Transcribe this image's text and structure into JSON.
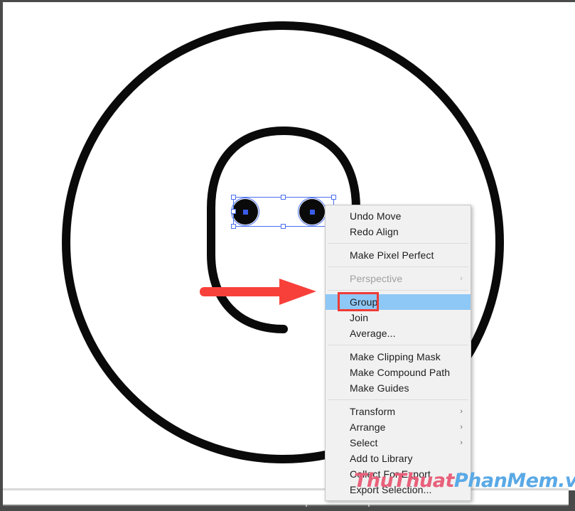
{
  "app": {
    "artwork_description": "Letter G vector outline with two selected circular eye shapes",
    "stroke_color": "#0a0a0a",
    "selection_color": "#4a6ff0"
  },
  "annotation": {
    "arrow_color": "#f8403a",
    "marker_color": "#ef3b36",
    "marker_target": "Group"
  },
  "context_menu": {
    "highlight_color": "#8ec8f6",
    "background_color": "#f1f1f1",
    "groups": [
      {
        "items": [
          {
            "label": "Undo Move",
            "disabled": false,
            "submenu": false,
            "highlighted": false
          },
          {
            "label": "Redo Align",
            "disabled": false,
            "submenu": false,
            "highlighted": false
          }
        ]
      },
      {
        "items": [
          {
            "label": "Make Pixel Perfect",
            "disabled": false,
            "submenu": false,
            "highlighted": false
          }
        ]
      },
      {
        "items": [
          {
            "label": "Perspective",
            "disabled": true,
            "submenu": true,
            "highlighted": false
          }
        ]
      },
      {
        "items": [
          {
            "label": "Group",
            "disabled": false,
            "submenu": false,
            "highlighted": true
          },
          {
            "label": "Join",
            "disabled": false,
            "submenu": false,
            "highlighted": false
          },
          {
            "label": "Average...",
            "disabled": false,
            "submenu": false,
            "highlighted": false
          }
        ]
      },
      {
        "items": [
          {
            "label": "Make Clipping Mask",
            "disabled": false,
            "submenu": false,
            "highlighted": false
          },
          {
            "label": "Make Compound Path",
            "disabled": false,
            "submenu": false,
            "highlighted": false
          },
          {
            "label": "Make Guides",
            "disabled": false,
            "submenu": false,
            "highlighted": false
          }
        ]
      },
      {
        "items": [
          {
            "label": "Transform",
            "disabled": false,
            "submenu": true,
            "highlighted": false
          },
          {
            "label": "Arrange",
            "disabled": false,
            "submenu": true,
            "highlighted": false
          },
          {
            "label": "Select",
            "disabled": false,
            "submenu": true,
            "highlighted": false
          },
          {
            "label": "Add to Library",
            "disabled": false,
            "submenu": false,
            "highlighted": false
          },
          {
            "label": "Collect For Export",
            "disabled": false,
            "submenu": true,
            "highlighted": false
          },
          {
            "label": "Export Selection...",
            "disabled": false,
            "submenu": false,
            "highlighted": false
          }
        ]
      }
    ],
    "submenu_glyph": "›"
  },
  "watermark": {
    "part_one": "ThuThuat",
    "part_two": "PhanMem.vn",
    "color_one": "#e8607a",
    "color_two": "#5aa9e6"
  }
}
